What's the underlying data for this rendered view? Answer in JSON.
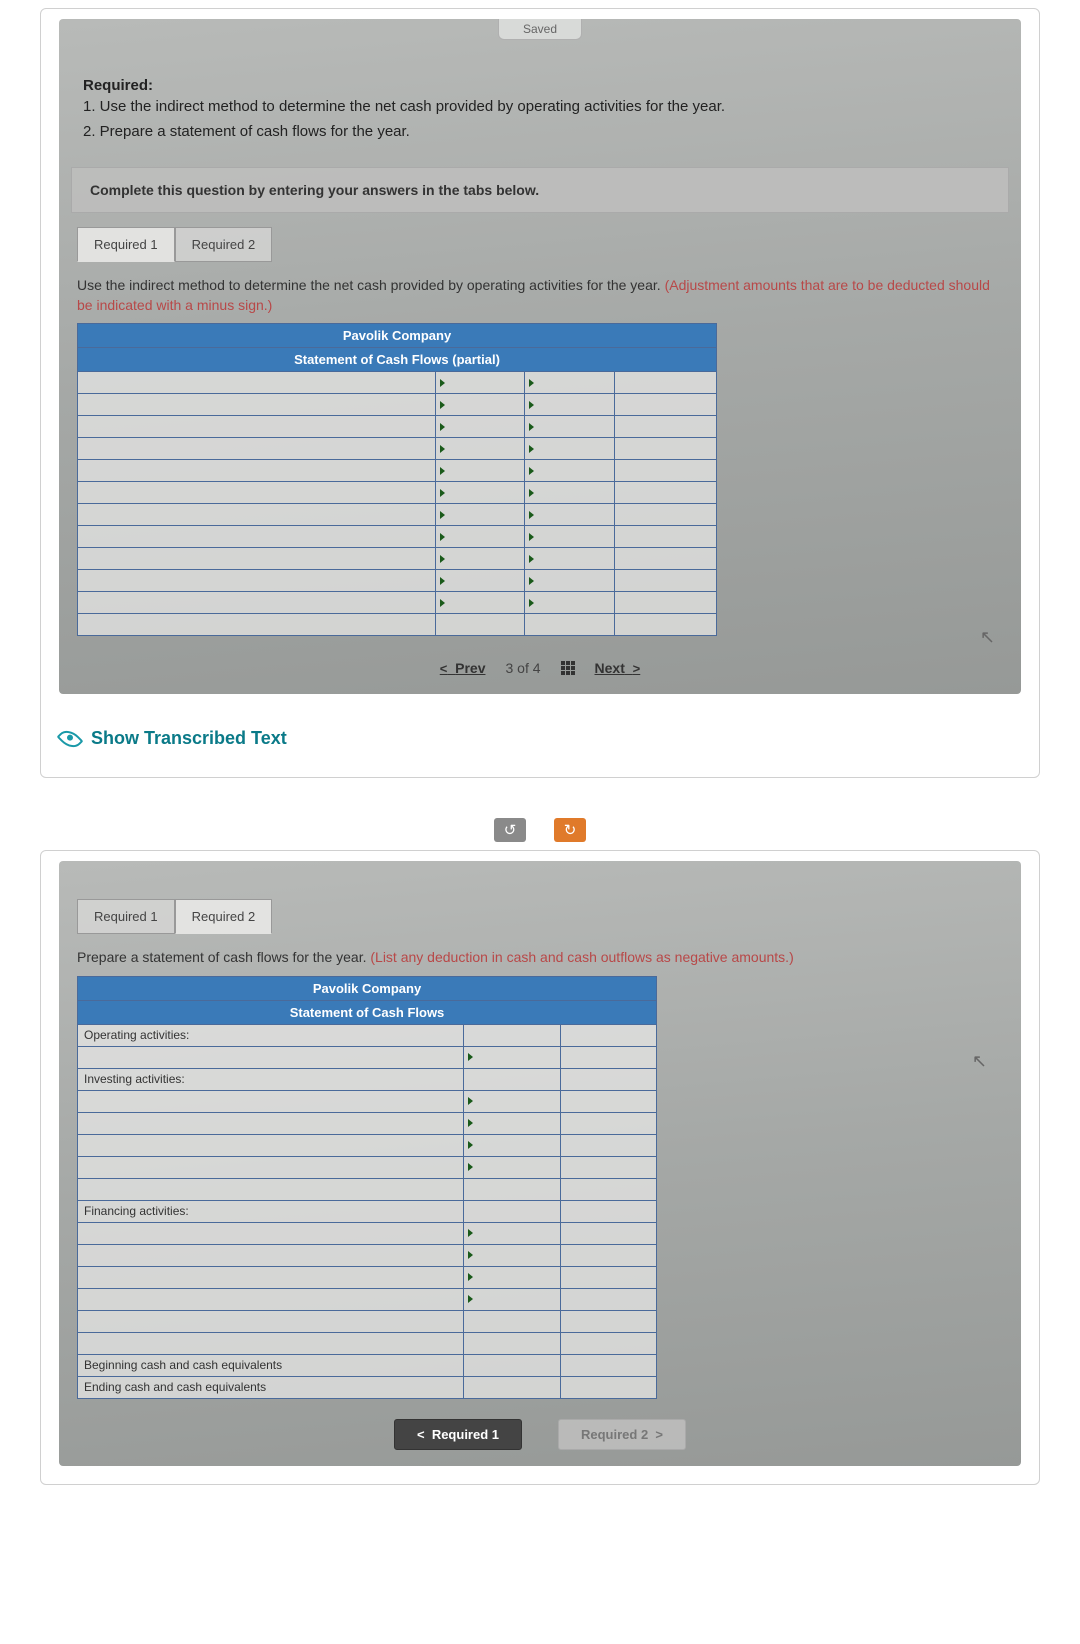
{
  "saved_label": "Saved",
  "req": {
    "title": "Required:",
    "item1": "1. Use the indirect method to determine the net cash provided by operating activities for the year.",
    "item2": "2. Prepare a statement of cash flows for the year."
  },
  "instruction": "Complete this question by entering your answers in the tabs below.",
  "tabs": {
    "r1": "Required 1",
    "r2": "Required 2"
  },
  "prompt1": {
    "main": "Use the indirect method to determine the net cash provided by operating activities for the year. ",
    "hint": "(Adjustment amounts that are to be deducted should be indicated with a minus sign.)"
  },
  "company": "Pavolik Company",
  "stmt_partial": "Statement of Cash Flows (partial)",
  "stmt_full": "Statement of Cash Flows",
  "pager": {
    "prev": "Prev",
    "pos": "3 of 4",
    "next": "Next"
  },
  "transcribed": "Show Transcribed Text",
  "prompt2": {
    "main": "Prepare a statement of cash flows for the year. ",
    "hint": "(List any deduction in cash and cash outflows as negative amounts.)"
  },
  "sections": {
    "op": "Operating activities:",
    "inv": "Investing activities:",
    "fin": "Financing activities:",
    "beg": "Beginning cash and cash equivalents",
    "end": "Ending cash and cash equivalents"
  },
  "footer": {
    "back": "Required 1",
    "fwd": "Required 2"
  }
}
